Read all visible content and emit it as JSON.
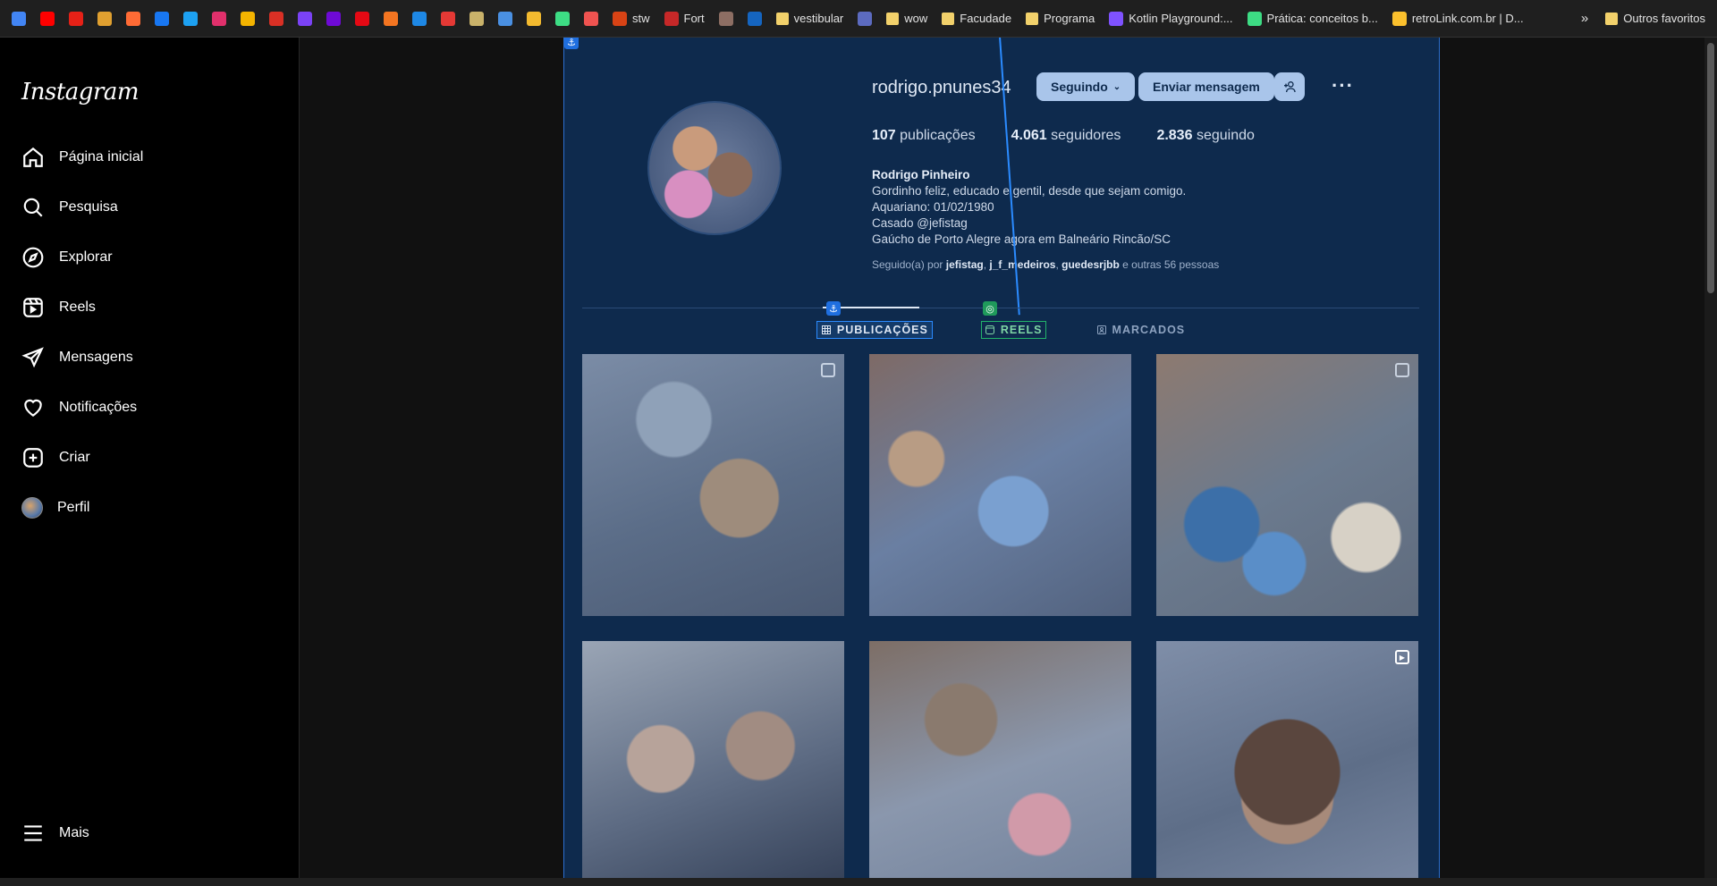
{
  "bookmarks": {
    "items": [
      {
        "label": "",
        "color": "#4285f4",
        "icon": "google-translate-icon"
      },
      {
        "label": "",
        "color": "#ff0000",
        "icon": "youtube-icon"
      },
      {
        "label": "",
        "color": "#e62117",
        "icon": "youtube-music-icon"
      },
      {
        "label": "",
        "color": "#e0a030",
        "icon": "slack-icon"
      },
      {
        "label": "",
        "color": "#ff6b35",
        "icon": "tool-icon"
      },
      {
        "label": "",
        "color": "#1877f2",
        "icon": "facebook-icon"
      },
      {
        "label": "",
        "color": "#1da1f2",
        "icon": "twitter-icon"
      },
      {
        "label": "",
        "color": "#e1306c",
        "icon": "instagram-icon"
      },
      {
        "label": "",
        "color": "#f4b400",
        "icon": "photos-icon"
      },
      {
        "label": "",
        "color": "#d93025",
        "icon": "gmail-icon"
      },
      {
        "label": "",
        "color": "#7b42f6",
        "icon": "app-icon"
      },
      {
        "label": "",
        "color": "#6e0ad6",
        "icon": "olx-icon"
      },
      {
        "label": "",
        "color": "#e50914",
        "icon": "netflix-icon"
      },
      {
        "label": "",
        "color": "#f47521",
        "icon": "crunchyroll-icon"
      },
      {
        "label": "",
        "color": "#1e88e5",
        "icon": "play-icon"
      },
      {
        "label": "",
        "color": "#e53935",
        "icon": "video-icon"
      },
      {
        "label": "",
        "color": "#c9b26a",
        "icon": "app-icon"
      },
      {
        "label": "",
        "color": "#4a90e2",
        "icon": "app-icon"
      },
      {
        "label": "",
        "color": "#f3ba2f",
        "icon": "binance-icon"
      },
      {
        "label": "",
        "color": "#3ddc84",
        "icon": "app-icon"
      },
      {
        "label": "",
        "color": "#ef5350",
        "icon": "app-icon"
      },
      {
        "label": "stw",
        "color": "#d84315",
        "icon": "stw-icon"
      },
      {
        "label": "Fort",
        "color": "#c62828",
        "icon": "ge-icon"
      },
      {
        "label": "",
        "color": "#8d6e63",
        "icon": "app-icon"
      },
      {
        "label": "",
        "color": "#1565c0",
        "icon": "x-icon"
      },
      {
        "label": "vestibular",
        "color": "#f2d16b",
        "icon": "folder-icon"
      },
      {
        "label": "",
        "color": "#5c6bc0",
        "icon": "app-icon"
      },
      {
        "label": "wow",
        "color": "#f2d16b",
        "icon": "folder-icon"
      },
      {
        "label": "Facudade",
        "color": "#f2d16b",
        "icon": "folder-icon"
      },
      {
        "label": "Programa",
        "color": "#f2d16b",
        "icon": "folder-icon"
      },
      {
        "label": "Kotlin Playground:...",
        "color": "#7f52ff",
        "icon": "kotlin-icon"
      },
      {
        "label": "Prática: conceitos b...",
        "color": "#3ddc84",
        "icon": "android-icon"
      },
      {
        "label": "retroLink.com.br | D...",
        "color": "#fbc02d",
        "icon": "retrolink-icon"
      }
    ],
    "overflow": "»",
    "other_favorites": "Outros favoritos"
  },
  "sidebar": {
    "logo": "Instagram",
    "items": [
      {
        "label": "Página inicial",
        "icon": "home-icon"
      },
      {
        "label": "Pesquisa",
        "icon": "search-icon"
      },
      {
        "label": "Explorar",
        "icon": "compass-icon"
      },
      {
        "label": "Reels",
        "icon": "reels-icon"
      },
      {
        "label": "Mensagens",
        "icon": "send-icon"
      },
      {
        "label": "Notificações",
        "icon": "heart-icon"
      },
      {
        "label": "Criar",
        "icon": "plus-square-icon"
      },
      {
        "label": "Perfil",
        "icon": "avatar-icon"
      }
    ],
    "more": "Mais"
  },
  "profile": {
    "username": "rodrigo.pnunes34",
    "follow_button": "Seguindo",
    "message_button": "Enviar mensagem",
    "add_person_button": "+&",
    "more": "···",
    "stats": {
      "posts_count": "107",
      "posts_label": "publicações",
      "followers_count": "4.061",
      "followers_label": "seguidores",
      "following_count": "2.836",
      "following_label": "seguindo"
    },
    "full_name": "Rodrigo Pinheiro",
    "bio_lines": [
      "Gordinho feliz, educado e gentil, desde que sejam comigo.",
      "Aquariano: 01/02/1980",
      "Casado @jefistag",
      "Gaúcho de Porto Alegre agora em Balneário Rincão/SC"
    ],
    "followed_by_prefix": "Seguido(a) por",
    "followed_by_users": [
      "jefistag",
      "j_f_medeiros",
      "guedesrjbb"
    ],
    "followed_by_suffix": "e outras 56 pessoas"
  },
  "tabs": [
    {
      "label": "PUBLICAÇÕES",
      "icon": "grid-icon",
      "active": true
    },
    {
      "label": "REELS",
      "icon": "reels-icon",
      "active": false
    },
    {
      "label": "MARCADOS",
      "icon": "tagged-icon",
      "active": false
    }
  ],
  "posts": [
    {
      "id": "post-1",
      "type": "carousel"
    },
    {
      "id": "post-2",
      "type": "image"
    },
    {
      "id": "post-3",
      "type": "carousel"
    },
    {
      "id": "post-4",
      "type": "image"
    },
    {
      "id": "post-5",
      "type": "image"
    },
    {
      "id": "post-6",
      "type": "reel"
    }
  ],
  "colors": {
    "overlay_panel": "#0e2a4d",
    "overlay_border": "#2b6fcf",
    "active_tab_badge": "#1f6fe0",
    "reels_tab_badge": "#1f9a5b"
  }
}
